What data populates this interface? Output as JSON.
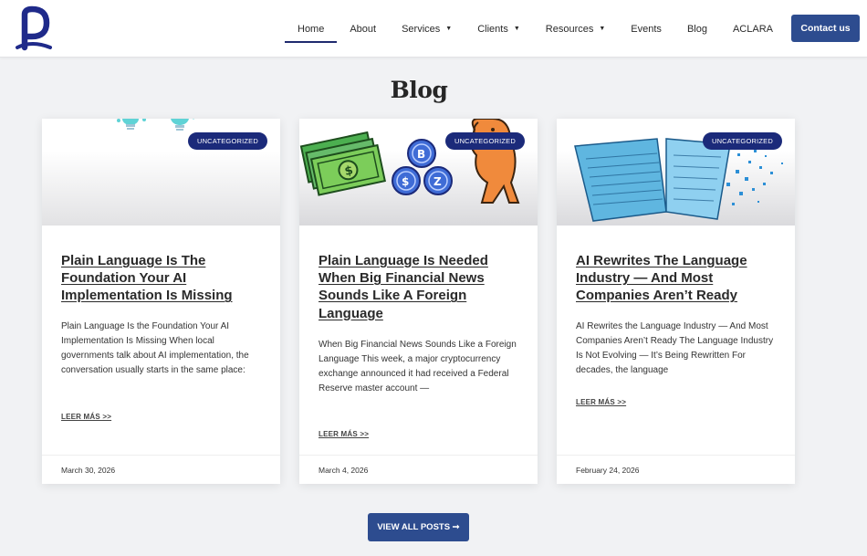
{
  "header": {
    "logo_name": "company-logo",
    "nav": [
      {
        "label": "Home",
        "active": true,
        "dropdown": false
      },
      {
        "label": "About",
        "active": false,
        "dropdown": false
      },
      {
        "label": "Services",
        "active": false,
        "dropdown": true
      },
      {
        "label": "Clients",
        "active": false,
        "dropdown": true
      },
      {
        "label": "Resources",
        "active": false,
        "dropdown": true
      },
      {
        "label": "Events",
        "active": false,
        "dropdown": false
      },
      {
        "label": "Blog",
        "active": false,
        "dropdown": false
      },
      {
        "label": "ACLARA",
        "active": false,
        "dropdown": false
      }
    ],
    "contact_label": "Contact us"
  },
  "main": {
    "title": "Blog",
    "posts": [
      {
        "badge": "UNCATEGORIZED",
        "title": "Plain Language Is The Foundation Your AI Implementation Is Missing",
        "excerpt": "Plain Language Is the Foundation Your AI Implementation Is Missing When local governments talk about AI implementation, the conversation usually starts in the same place:",
        "read_more": "LEER MÁS >>",
        "date": "March 30, 2026"
      },
      {
        "badge": "UNCATEGORIZED",
        "title": "Plain Language Is Needed When Big Financial News Sounds Like A Foreign Language",
        "excerpt": "When Big Financial News Sounds Like a Foreign Language This week, a major cryptocurrency exchange announced it had received a Federal Reserve master account —",
        "read_more": "LEER MÁS >>",
        "date": "March 4, 2026"
      },
      {
        "badge": "UNCATEGORIZED",
        "title": "AI Rewrites The Language Industry — And Most Companies Aren’t Ready",
        "excerpt": "AI Rewrites the Language Industry — And Most Companies Aren’t Ready The Language Industry Is Not Evolving — It’s Being Rewritten For decades, the language",
        "read_more": "LEER MÁS >>",
        "date": "February 24, 2026"
      }
    ],
    "view_all_label": "VIEW ALL POSTS ➞"
  },
  "colors": {
    "primary": "#2d4c8f",
    "badge": "#1b2a7a",
    "logo": "#1f2a8a",
    "background": "#f1f2f4"
  }
}
